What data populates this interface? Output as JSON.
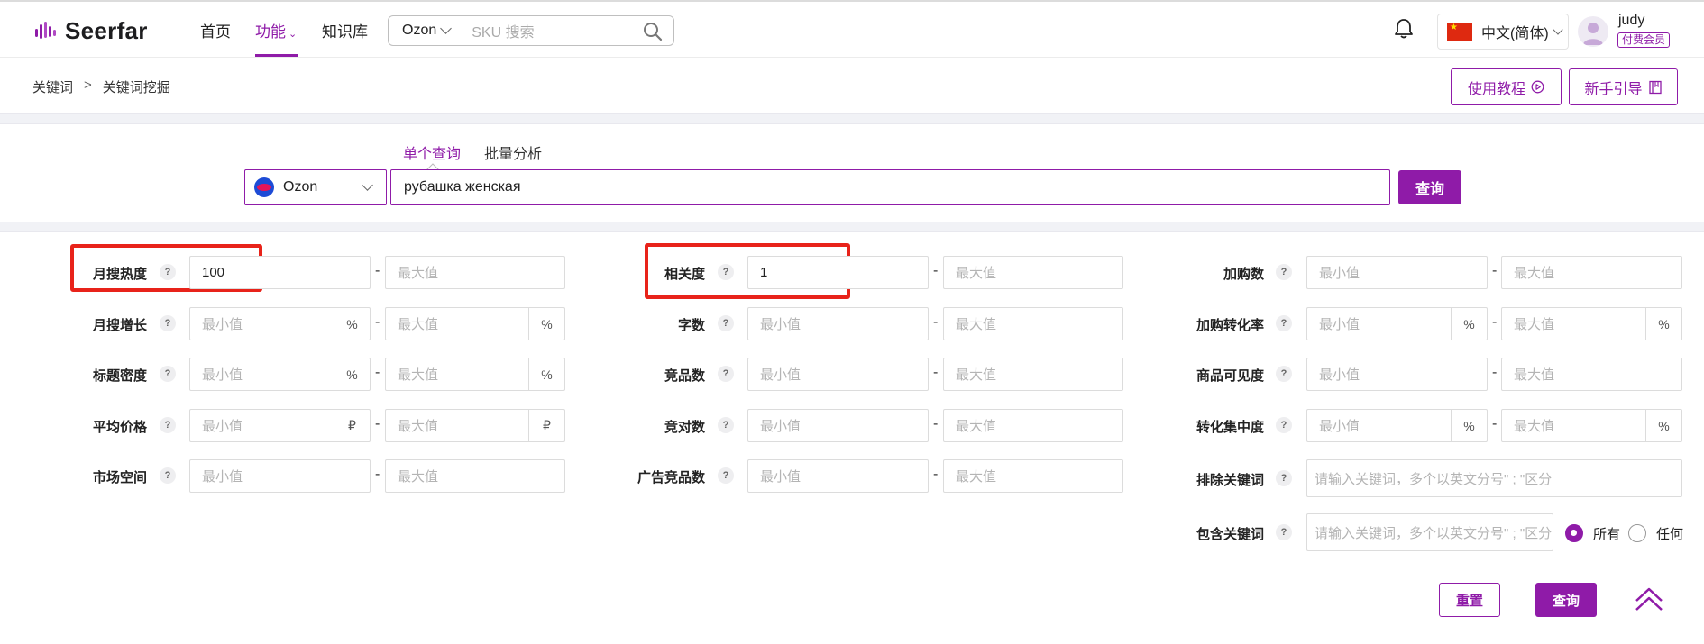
{
  "header": {
    "logo_text": "Seerfar",
    "nav": [
      {
        "label": "首页"
      },
      {
        "label": "功能"
      },
      {
        "label": "知识库"
      }
    ],
    "sku_search": {
      "platform": "Ozon",
      "placeholder": "SKU 搜索"
    },
    "language": "中文(简体)",
    "user": {
      "name": "judy",
      "badge": "付费会员"
    }
  },
  "breadcrumb": {
    "items": [
      "关键词",
      "关键词挖掘"
    ],
    "separator": ">"
  },
  "top_buttons": {
    "tutorial": "使用教程",
    "guide": "新手引导"
  },
  "search": {
    "tabs": [
      "单个查询",
      "批量分析"
    ],
    "platform": "Ozon",
    "keyword": "рубашка женская",
    "submit": "查询"
  },
  "filters": {
    "col1": [
      {
        "label": "月搜热度",
        "min": "100",
        "max_placeholder": "最大值"
      },
      {
        "label": "月搜增长",
        "min_placeholder": "最小值",
        "max_placeholder": "最大值",
        "unit": "%"
      },
      {
        "label": "标题密度",
        "min_placeholder": "最小值",
        "max_placeholder": "最大值",
        "unit": "%"
      },
      {
        "label": "平均价格",
        "min_placeholder": "最小值",
        "max_placeholder": "最大值",
        "unit": "₽"
      },
      {
        "label": "市场空间",
        "min_placeholder": "最小值",
        "max_placeholder": "最大值"
      }
    ],
    "col2": [
      {
        "label": "相关度",
        "min": "1",
        "max_placeholder": "最大值"
      },
      {
        "label": "字数",
        "min_placeholder": "最小值",
        "max_placeholder": "最大值"
      },
      {
        "label": "竞品数",
        "min_placeholder": "最小值",
        "max_placeholder": "最大值"
      },
      {
        "label": "竞对数",
        "min_placeholder": "最小值",
        "max_placeholder": "最大值"
      },
      {
        "label": "广告竞品数",
        "min_placeholder": "最小值",
        "max_placeholder": "最大值"
      }
    ],
    "col3": [
      {
        "label": "加购数",
        "min_placeholder": "最小值",
        "max_placeholder": "最大值"
      },
      {
        "label": "加购转化率",
        "min_placeholder": "最小值",
        "max_placeholder": "最大值",
        "unit": "%"
      },
      {
        "label": "商品可见度",
        "min_placeholder": "最小值",
        "max_placeholder": "最大值"
      },
      {
        "label": "转化集中度",
        "min_placeholder": "最小值",
        "max_placeholder": "最大值",
        "unit": "%"
      },
      {
        "label": "排除关键词",
        "placeholder": "请输入关键词，多个以英文分号\" ; \"区分"
      },
      {
        "label": "包含关键词",
        "placeholder": "请输入关键词，多个以英文分号\" ; \"区分"
      }
    ],
    "dash": "-",
    "help": "?",
    "match_options": {
      "all": "所有",
      "any": "任何"
    }
  },
  "actions": {
    "reset": "重置",
    "query": "查询"
  },
  "colors": {
    "accent": "#8f1ba8",
    "highlight": "#e8231a"
  }
}
